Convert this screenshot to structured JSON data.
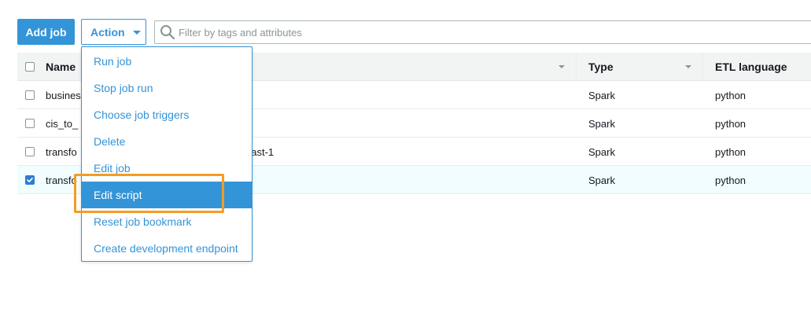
{
  "toolbar": {
    "add_job_label": "Add job",
    "action_label": "Action",
    "search_placeholder": "Filter by tags and attributes"
  },
  "table": {
    "columns": [
      "Name",
      "Type",
      "ETL language"
    ],
    "rows": [
      {
        "name": "busines",
        "name_tail": "",
        "type": "Spark",
        "etl": "python",
        "checked": false
      },
      {
        "name": "cis_to_",
        "name_tail": "",
        "type": "Spark",
        "etl": "python",
        "checked": false
      },
      {
        "name": "transfo",
        "name_tail": "east-1",
        "type": "Spark",
        "etl": "python",
        "checked": false
      },
      {
        "name": "transfo",
        "name_tail": "",
        "type": "Spark",
        "etl": "python",
        "checked": true
      }
    ]
  },
  "action_menu": {
    "items": [
      {
        "label": "Run job"
      },
      {
        "label": "Stop job run"
      },
      {
        "label": "Choose job triggers"
      },
      {
        "label": "Delete"
      },
      {
        "label": "Edit job"
      },
      {
        "label": "Edit script",
        "active": true
      },
      {
        "label": "Reset job bookmark"
      },
      {
        "label": "Create development endpoint"
      }
    ]
  },
  "colors": {
    "accent": "#3494d8",
    "highlight": "#f49c23",
    "selected_row": "#f1fdff"
  }
}
